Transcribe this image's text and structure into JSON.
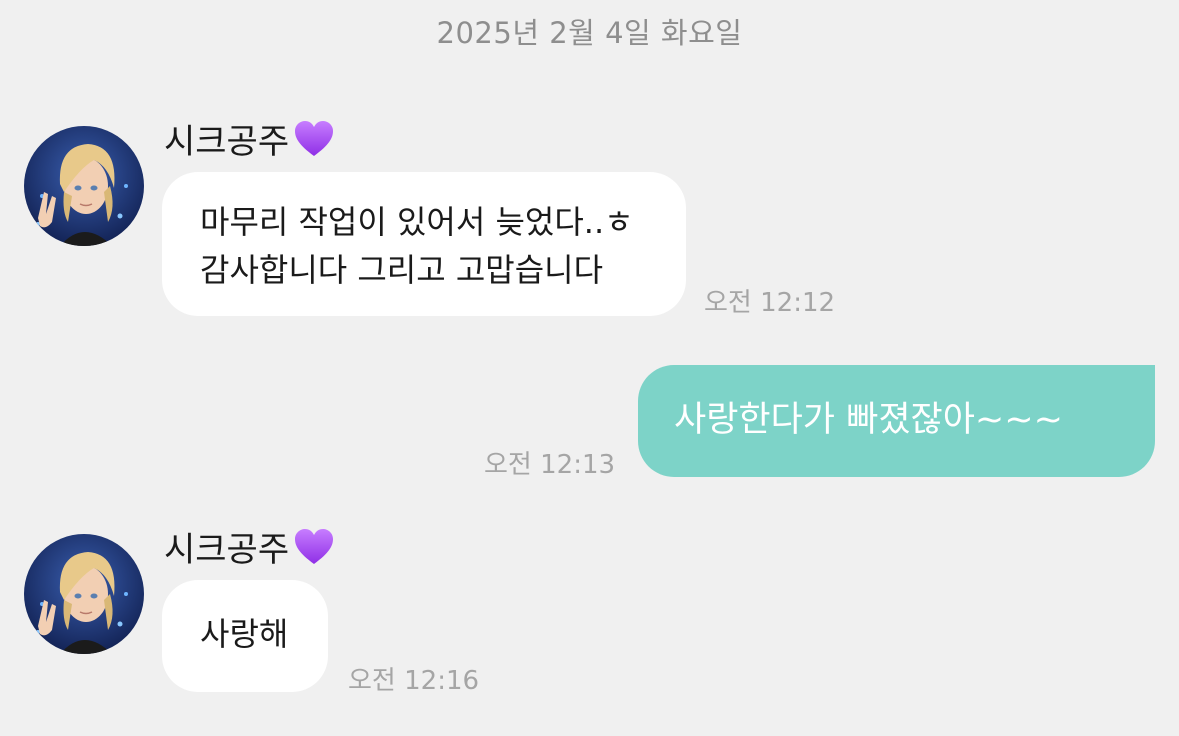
{
  "chat": {
    "date_divider": "2025년 2월 4일 화요일",
    "messages": [
      {
        "direction": "incoming",
        "sender": "시크공주",
        "lines": [
          "마무리 작업이 있어서 늦었다..ㅎ",
          "감사합니다 그리고 고맙습니다"
        ],
        "time": "오전 12:12"
      },
      {
        "direction": "outgoing",
        "lines": [
          "사랑한다가 빠졌잖아~~~"
        ],
        "time": "오전 12:13"
      },
      {
        "direction": "incoming",
        "sender": "시크공주",
        "lines": [
          "사랑해"
        ],
        "time": "오전 12:16"
      }
    ]
  },
  "icons": {
    "sender_badge": "purple-heart-icon",
    "avatar": "profile-avatar"
  },
  "colors": {
    "background": "#f0f0f0",
    "incoming_bubble": "#ffffff",
    "outgoing_bubble": "#7dd3c8",
    "heart": "#a64df5",
    "timestamp": "#a5a5a5"
  }
}
